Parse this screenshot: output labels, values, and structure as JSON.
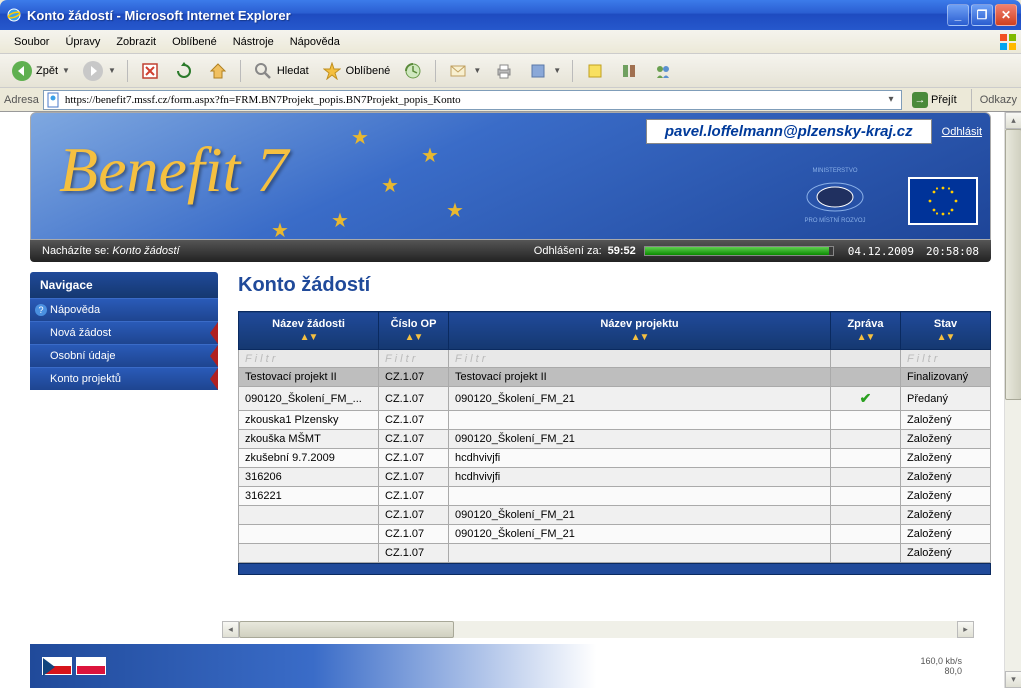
{
  "window": {
    "title": "Konto žádostí - Microsoft Internet Explorer"
  },
  "menu": {
    "items": [
      "Soubor",
      "Úpravy",
      "Zobrazit",
      "Oblíbené",
      "Nástroje",
      "Nápověda"
    ]
  },
  "toolbar": {
    "back_label": "Zpět",
    "search_label": "Hledat",
    "favorites_label": "Oblíbené"
  },
  "addressbar": {
    "label": "Adresa",
    "url": "https://benefit7.mssf.cz/form.aspx?fn=FRM.BN7Projekt_popis.BN7Projekt_popis_Konto",
    "go_label": "Přejít",
    "links_label": "Odkazy"
  },
  "banner": {
    "logo_text": "Benefit 7",
    "user_email": "pavel.loffelmann@plzensky-kraj.cz",
    "logout_label": "Odhlásit"
  },
  "status": {
    "location_prefix": "Nacházíte se:",
    "location_value": "Konto žádostí",
    "countdown_label": "Odhlášení za:",
    "countdown_value": "59:52",
    "date": "04.12.2009",
    "time": "20:58:08"
  },
  "sidebar": {
    "header": "Navigace",
    "items": [
      {
        "label": "Nápověda",
        "help_icon": true,
        "red_corner": false
      },
      {
        "label": "Nová žádost",
        "help_icon": false,
        "red_corner": true
      },
      {
        "label": "Osobní údaje",
        "help_icon": false,
        "red_corner": true
      },
      {
        "label": "Konto projektů",
        "help_icon": false,
        "red_corner": true
      }
    ]
  },
  "page": {
    "title": "Konto žádostí"
  },
  "table": {
    "columns": [
      "Název žádosti",
      "Číslo OP",
      "Název projektu",
      "Zpráva",
      "Stav"
    ],
    "filter_placeholder": "F i l t r",
    "rows": [
      {
        "nazev_zadosti": "Testovací projekt II",
        "cislo_op": "CZ.1.07",
        "nazev_projektu": "Testovací projekt II",
        "zprava": "",
        "stav": "Finalizovaný",
        "selected": true
      },
      {
        "nazev_zadosti": "090120_Školení_FM_...",
        "cislo_op": "CZ.1.07",
        "nazev_projektu": "090120_Školení_FM_21",
        "zprava": "check",
        "stav": "Předaný"
      },
      {
        "nazev_zadosti": "zkouska1 Plzensky",
        "cislo_op": "CZ.1.07",
        "nazev_projektu": "",
        "zprava": "",
        "stav": "Založený"
      },
      {
        "nazev_zadosti": "zkouška MŠMT",
        "cislo_op": "CZ.1.07",
        "nazev_projektu": "090120_Školení_FM_21",
        "zprava": "",
        "stav": "Založený"
      },
      {
        "nazev_zadosti": "zkušební 9.7.2009",
        "cislo_op": "CZ.1.07",
        "nazev_projektu": "hcdhvivjfi",
        "zprava": "",
        "stav": "Založený"
      },
      {
        "nazev_zadosti": "316206",
        "cislo_op": "CZ.1.07",
        "nazev_projektu": "hcdhvivjfi",
        "zprava": "",
        "stav": "Založený"
      },
      {
        "nazev_zadosti": "316221",
        "cislo_op": "CZ.1.07",
        "nazev_projektu": "",
        "zprava": "",
        "stav": "Založený"
      },
      {
        "nazev_zadosti": "",
        "cislo_op": "CZ.1.07",
        "nazev_projektu": "090120_Školení_FM_21",
        "zprava": "",
        "stav": "Založený"
      },
      {
        "nazev_zadosti": "",
        "cislo_op": "CZ.1.07",
        "nazev_projektu": "090120_Školení_FM_21",
        "zprava": "",
        "stav": "Založený"
      },
      {
        "nazev_zadosti": "",
        "cislo_op": "CZ.1.07",
        "nazev_projektu": "",
        "zprava": "",
        "stav": "Založený"
      }
    ]
  },
  "net": {
    "line1": "160,0",
    "unit": "kb/s",
    "line2": "80,0"
  }
}
